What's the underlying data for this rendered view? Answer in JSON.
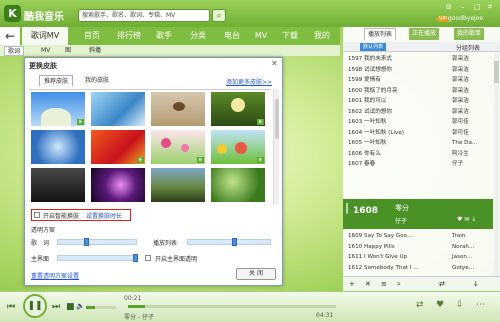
{
  "app": {
    "name": "酷我音乐",
    "logo_text": "K"
  },
  "search": {
    "placeholder": "搜索歌手、歌名、歌词、专辑、MV",
    "button": "⌕"
  },
  "user": {
    "vip": "VIP",
    "name": "goodbyejoe"
  },
  "window_controls": [
    "⊟",
    "–",
    "□",
    "✕"
  ],
  "nav": {
    "back": "←",
    "tabs": [
      "歌词MV",
      "首页",
      "排行榜",
      "歌手",
      "分类",
      "电台",
      "MV",
      "下载",
      "我的"
    ]
  },
  "subnav": [
    "歌词",
    "MV",
    "图",
    "斜播"
  ],
  "dialog": {
    "title": "更换皮肤",
    "close": "✕",
    "tabs": [
      "推荐皮肤",
      "我的皮肤"
    ],
    "add_link": "添加更多皮肤>>",
    "thumbs": [
      {
        "name": "sky-blue",
        "badge": "新"
      },
      {
        "name": "wave-blue",
        "badge": ""
      },
      {
        "name": "butterfly",
        "badge": ""
      },
      {
        "name": "green-sunset",
        "badge": "新"
      },
      {
        "name": "blue-light",
        "badge": ""
      },
      {
        "name": "red-orange",
        "badge": "新"
      },
      {
        "name": "pink-flower",
        "badge": "新"
      },
      {
        "name": "cartoon-garden",
        "badge": "新"
      },
      {
        "name": "dark",
        "badge": ""
      },
      {
        "name": "purple-sparkle",
        "badge": ""
      },
      {
        "name": "nature-panorama",
        "badge": ""
      },
      {
        "name": "forest-green",
        "badge": ""
      }
    ],
    "smart_change_label": "开启智能换肤",
    "interval_link": "设置换肤时长",
    "transparency_title": "透明方案",
    "lyrics_label": "歌　词",
    "playlist_label": "播放列表",
    "main_label": "主界面",
    "main_toggle_label": "开启主界面透明",
    "reset_link": "重置透明方案设置",
    "close_button": "关 闭"
  },
  "playlist": {
    "tabs": [
      "播放列表",
      "正在播放",
      "我的歌单"
    ],
    "default_button": "默认列表",
    "group_button": "分组列表",
    "rows": [
      {
        "t": "1597 我的未来式",
        "a": "郭采洁"
      },
      {
        "t": "1598 试试想想你",
        "a": "郭采洁"
      },
      {
        "t": "1599 爱情有",
        "a": "郭采洁"
      },
      {
        "t": "1600 我惦了的月亮",
        "a": "郭采洁"
      },
      {
        "t": "1601 我的可以",
        "a": "郭采洁"
      },
      {
        "t": "1602 试试的想你",
        "a": "郭采洁"
      },
      {
        "t": "1603 一叶知秋",
        "a": "郭可佳"
      },
      {
        "t": "1604 一叶知秋 (Live)",
        "a": "郭可佳"
      },
      {
        "t": "1605 一叶知秋",
        "a": "The Da…"
      },
      {
        "t": "1606 你有么",
        "a": "阿冷生"
      },
      {
        "t": "1607 春春",
        "a": "仔子"
      }
    ],
    "now_playing": {
      "number": "1608",
      "title": "零分",
      "artist": "仔子"
    },
    "rows_after": [
      {
        "t": "1609 Say To Say Goo…",
        "a": "Train"
      },
      {
        "t": "1610 Happy Pills",
        "a": "Norah…"
      },
      {
        "t": "1611 I Won't Give Up",
        "a": "Jason…"
      },
      {
        "t": "1612 Somebody That I …",
        "a": "Gotye…"
      }
    ],
    "bottom_icons": [
      "+",
      "✕",
      "≡",
      "⌕",
      "⇄",
      "↓"
    ]
  },
  "player": {
    "prev": "⏮",
    "play": "❚❚",
    "next": "⏭",
    "stop": "■",
    "volume_icon": "🔈",
    "time_current": "00:21",
    "time_total": "04:31",
    "song": "零分 - 仔子",
    "progress": 0.08,
    "volume": 0.3,
    "right_icons": [
      "⇄",
      "♥",
      "⇩",
      "⋯"
    ]
  }
}
